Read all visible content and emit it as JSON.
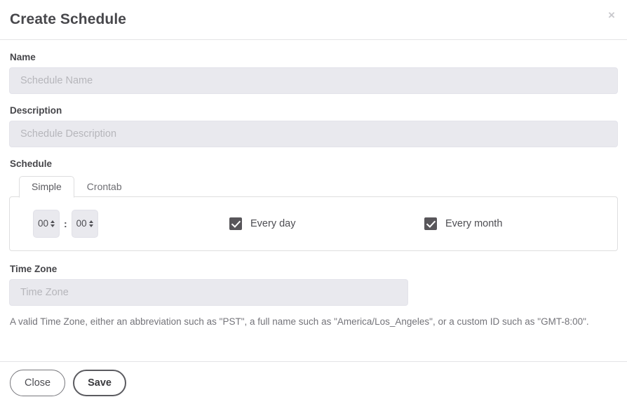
{
  "dialog": {
    "title": "Create Schedule",
    "close_icon_label": "×"
  },
  "fields": {
    "name": {
      "label": "Name",
      "placeholder": "Schedule Name",
      "value": ""
    },
    "description": {
      "label": "Description",
      "placeholder": "Schedule Description",
      "value": ""
    },
    "schedule": {
      "label": "Schedule",
      "tabs": [
        {
          "label": "Simple",
          "active": true
        },
        {
          "label": "Crontab",
          "active": false
        }
      ],
      "simple": {
        "hour_value": "00",
        "minute_value": "00",
        "separator": ":",
        "every_day": {
          "label": "Every day",
          "checked": true
        },
        "every_month": {
          "label": "Every month",
          "checked": true
        }
      }
    },
    "time_zone": {
      "label": "Time Zone",
      "placeholder": "Time Zone",
      "value": "",
      "help": "A valid Time Zone, either an abbreviation such as \"PST\", a full name such as \"America/Los_Angeles\", or a custom ID such as \"GMT-8:00\"."
    }
  },
  "footer": {
    "close_label": "Close",
    "save_label": "Save"
  },
  "colors": {
    "input_fill": "#e9e9ee",
    "checkbox_fill": "#58565a",
    "border": "#dededf",
    "text": "#4d4d52",
    "placeholder": "#b6b6bb"
  }
}
